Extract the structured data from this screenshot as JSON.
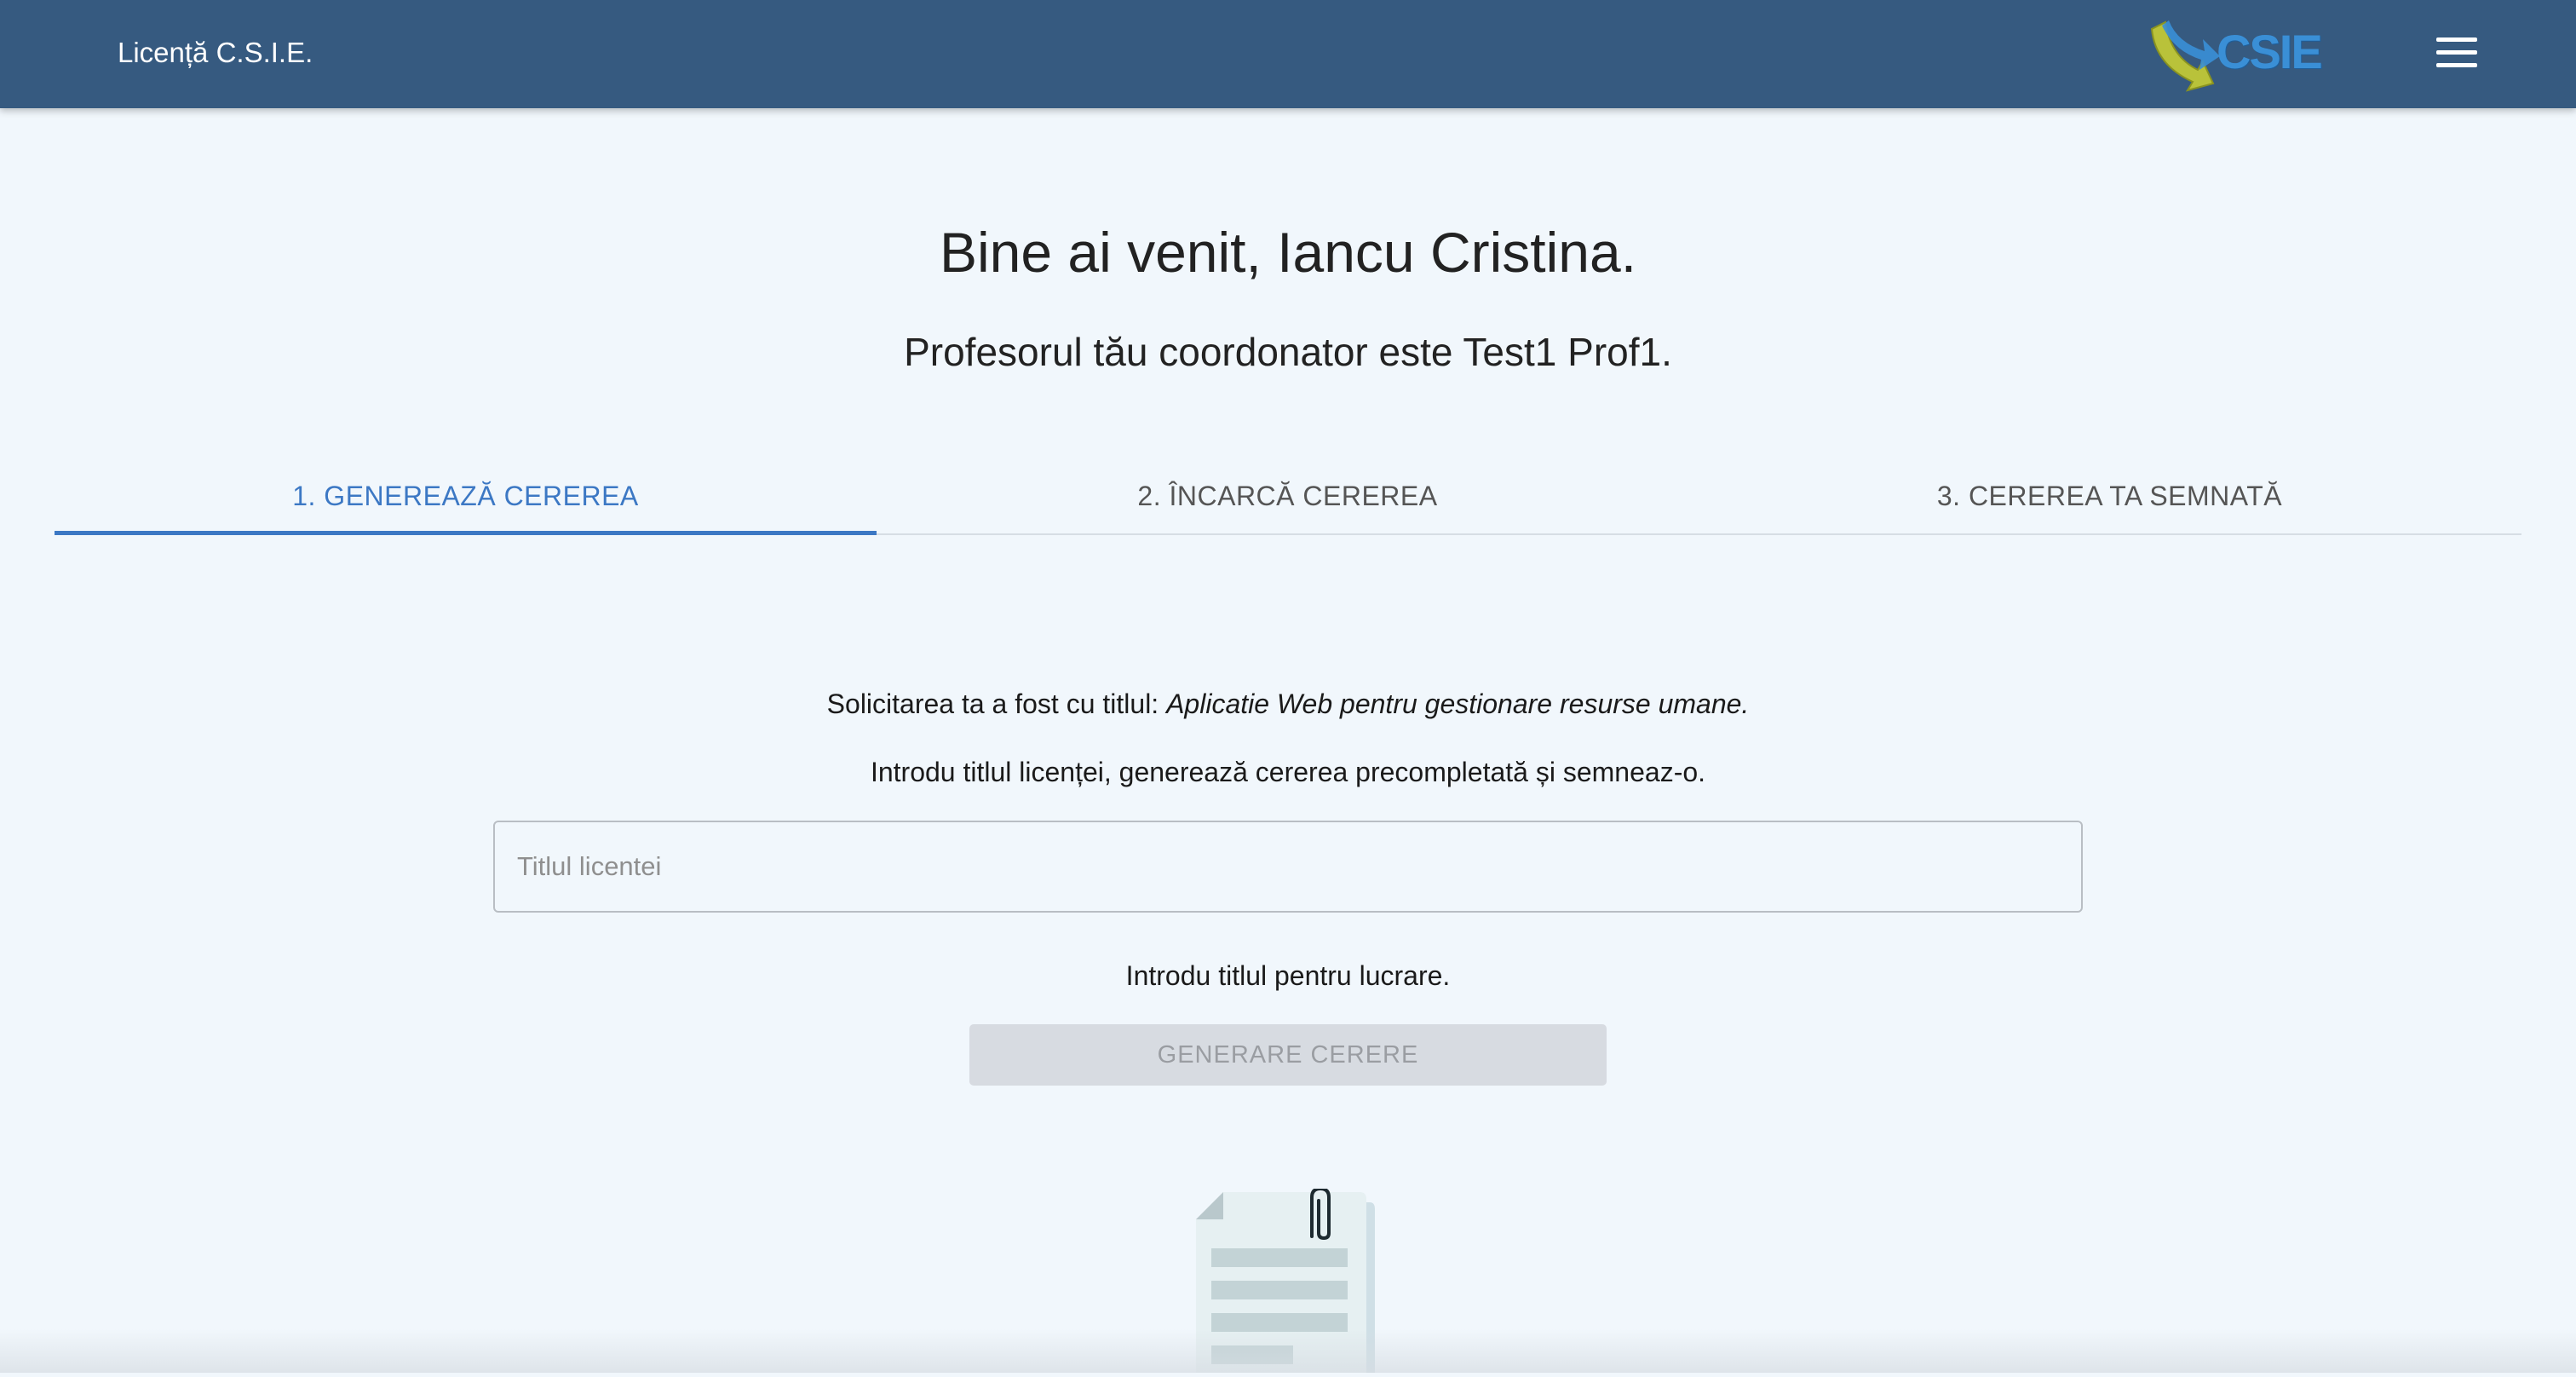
{
  "header": {
    "app_title": "Licență C.S.I.E.",
    "logo_text": "CSIE",
    "menu_icon": "hamburger-menu-icon"
  },
  "main": {
    "welcome": "Bine ai venit, Iancu Cristina.",
    "coordinator": "Profesorul tău coordonator este Test1 Prof1.",
    "tabs": [
      {
        "label": "1. GENEREAZĂ CEREREA",
        "active": true
      },
      {
        "label": "2. ÎNCARCĂ CEREREA",
        "active": false
      },
      {
        "label": "3. CEREREA TA SEMNATĂ",
        "active": false
      }
    ],
    "request_prefix": "Solicitarea ta a fost cu titlul: ",
    "request_title": "Aplicatie Web pentru gestionare resurse umane.",
    "instructions": "Introdu titlul licenței, generează cererea precompletată și semneaz-o.",
    "title_input": {
      "placeholder": "Titlul licentei",
      "value": ""
    },
    "helper_text": "Introdu titlul pentru lucrare.",
    "generate_button": "GENERARE CERERE",
    "illustration_icon": "document-paperclip-icon"
  },
  "colors": {
    "topbar": "#365a80",
    "background": "#f1f7fc",
    "accent": "#3c78c4",
    "disabled_button": "#d7dbe1"
  }
}
